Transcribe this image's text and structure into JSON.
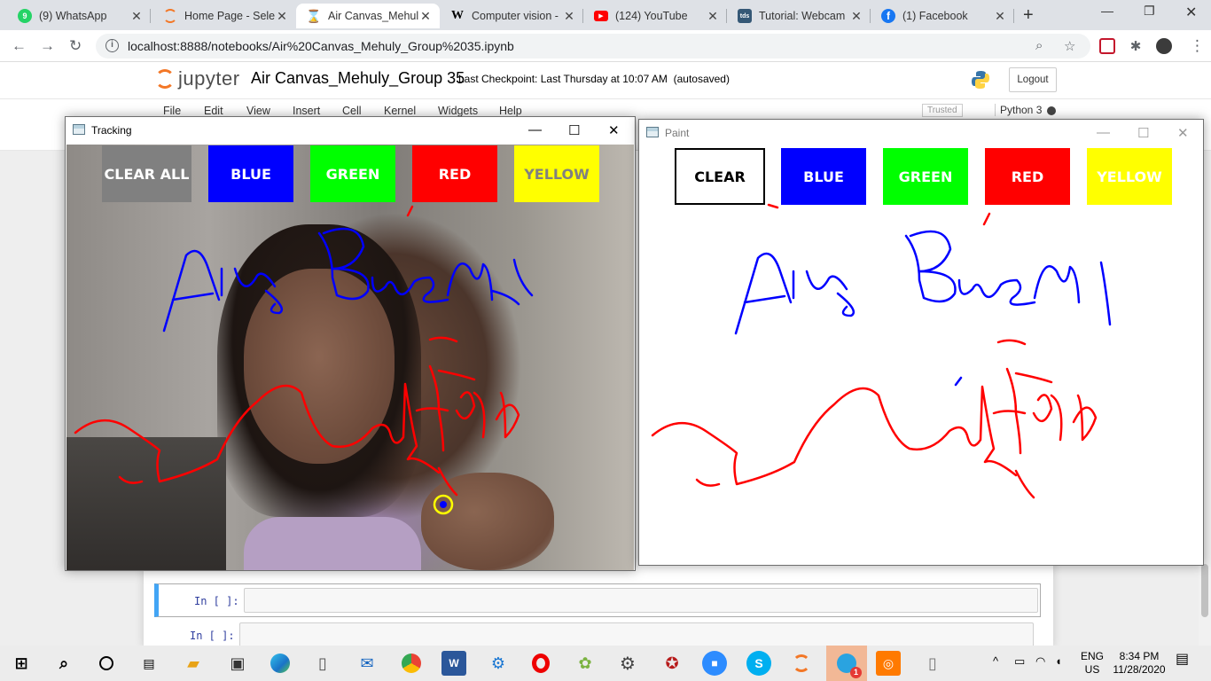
{
  "browser": {
    "tabs": [
      {
        "title": "(9) WhatsApp",
        "icon": "whatsapp-icon",
        "color": "#25d366",
        "badge": "9"
      },
      {
        "title": "Home Page - Sele",
        "icon": "jupyter-icon",
        "color": "#f37726",
        "badge": ""
      },
      {
        "title": "Air Canvas_Mehuly",
        "icon": "hourglass-icon",
        "color": "#f37726",
        "badge": ""
      },
      {
        "title": "Computer vision -",
        "icon": "wikipedia-icon",
        "color": "#000000",
        "badge": "W"
      },
      {
        "title": "(124) YouTube",
        "icon": "youtube-icon",
        "color": "#ff0000",
        "badge": "▶"
      },
      {
        "title": "Tutorial: Webcam",
        "icon": "tds-icon",
        "color": "#355876",
        "badge": "tds"
      },
      {
        "title": "(1) Facebook",
        "icon": "facebook-icon",
        "color": "#1877f2",
        "badge": "f"
      }
    ],
    "url": "localhost:8888/notebooks/Air%20Canvas_Mehuly_Group%2035.ipynb"
  },
  "jupyter": {
    "logo_text": "jupyter",
    "notebook_name": "Air Canvas_Mehuly_Group 35",
    "checkpoint": "Last Checkpoint: Last Thursday at 10:07 AM",
    "autosave": "(autosaved)",
    "logout": "Logout",
    "menu": [
      "File",
      "Edit",
      "View",
      "Insert",
      "Cell",
      "Kernel",
      "Widgets",
      "Help"
    ],
    "trusted": "Trusted",
    "kernel": "Python 3",
    "cells": [
      {
        "prompt": "In [ ]:"
      },
      {
        "prompt": "In [ ]:"
      }
    ]
  },
  "tracking_window": {
    "title": "Tracking",
    "buttons": [
      {
        "label": "CLEAR ALL",
        "bg": "#808080",
        "fg": "#ffffff"
      },
      {
        "label": "BLUE",
        "bg": "#0000ff",
        "fg": "#ffffff"
      },
      {
        "label": "GREEN",
        "bg": "#00ff00",
        "fg": "#ffffff"
      },
      {
        "label": "RED",
        "bg": "#ff0000",
        "fg": "#ffffff"
      },
      {
        "label": "YELLOW",
        "bg": "#ffff00",
        "fg": "#808080"
      }
    ]
  },
  "paint_window": {
    "title": "Paint",
    "buttons": [
      {
        "label": "CLEAR",
        "bg": "#ffffff",
        "fg": "#000000"
      },
      {
        "label": "BLUE",
        "bg": "#0000ff",
        "fg": "#ffffff"
      },
      {
        "label": "GREEN",
        "bg": "#00ff00",
        "fg": "#ffffff"
      },
      {
        "label": "RED",
        "bg": "#ff0000",
        "fg": "#ffffff"
      },
      {
        "label": "YELLOW",
        "bg": "#ffff00",
        "fg": "#ffffff"
      }
    ]
  },
  "colors": {
    "stroke_blue": "#0000ff",
    "stroke_red": "#ff0000",
    "pointer_yellow": "#ffff00"
  },
  "taskbar": {
    "lang": "ENG",
    "region": "US",
    "time": "8:34 PM",
    "date": "11/28/2020",
    "notifications_badge": "1"
  }
}
